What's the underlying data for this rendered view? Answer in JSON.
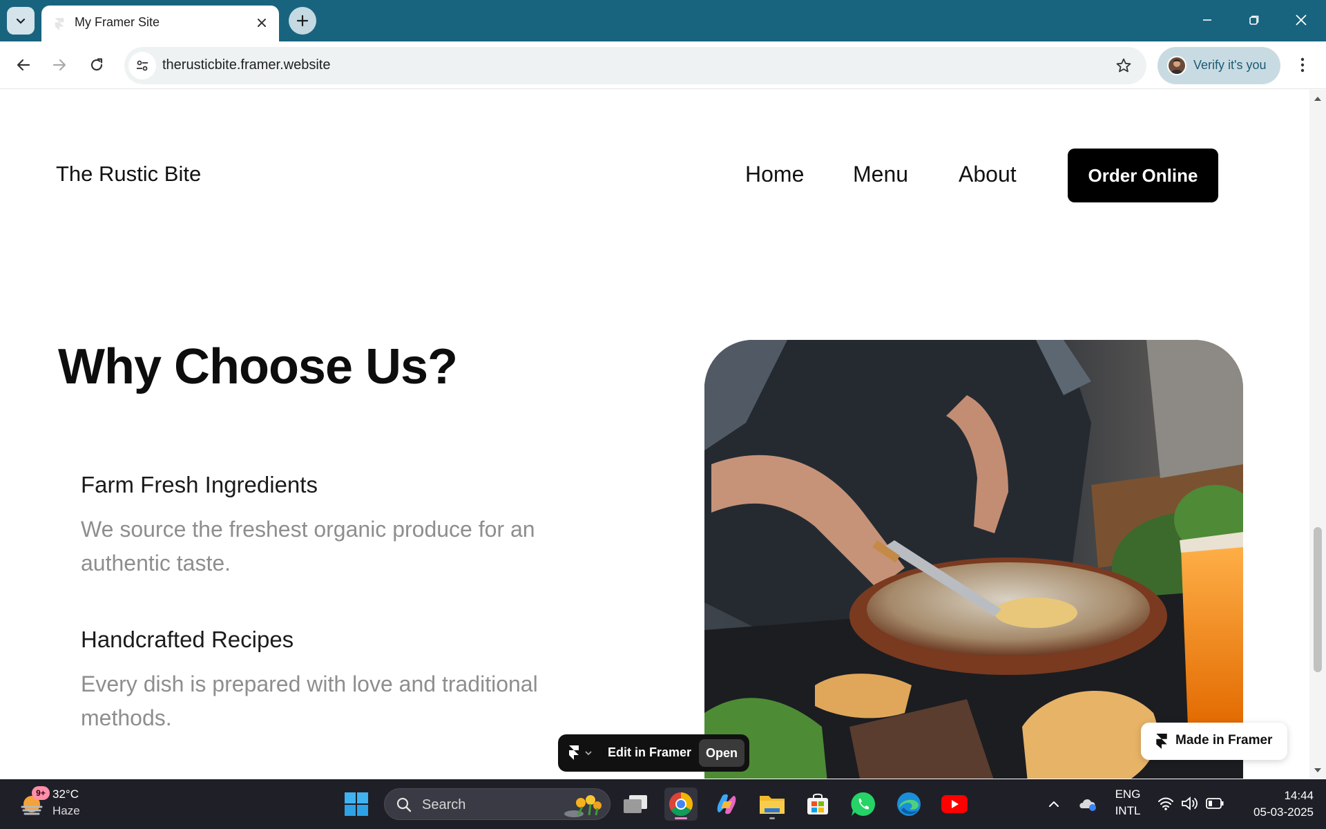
{
  "browser": {
    "tab_title": "My Framer Site",
    "url": "therusticbite.framer.website",
    "profile_label": "Verify it's you"
  },
  "site": {
    "brand": "The Rustic Bite",
    "nav": [
      "Home",
      "Menu",
      "About"
    ],
    "cta": "Order Online",
    "headline": "Why Choose Us?",
    "features": [
      {
        "title": "Farm Fresh Ingredients",
        "desc": "We source the freshest organic produce for an authentic taste."
      },
      {
        "title": "Handcrafted Recipes",
        "desc": "Every dish is prepared with love and traditional methods."
      }
    ]
  },
  "framer": {
    "edit_label": "Edit in Framer",
    "open_label": "Open",
    "made_label": "Made in Framer"
  },
  "taskbar": {
    "weather_badge": "9+",
    "temperature": "32°C",
    "condition": "Haze",
    "search_label": "Search",
    "lang_top": "ENG",
    "lang_bottom": "INTL",
    "time": "14:44",
    "date": "05-03-2025"
  },
  "colors": {
    "tabbar": "#18647f",
    "taskbar": "#1f1f28",
    "cta_bg": "#000000",
    "muted_text": "#8e8e8e"
  }
}
